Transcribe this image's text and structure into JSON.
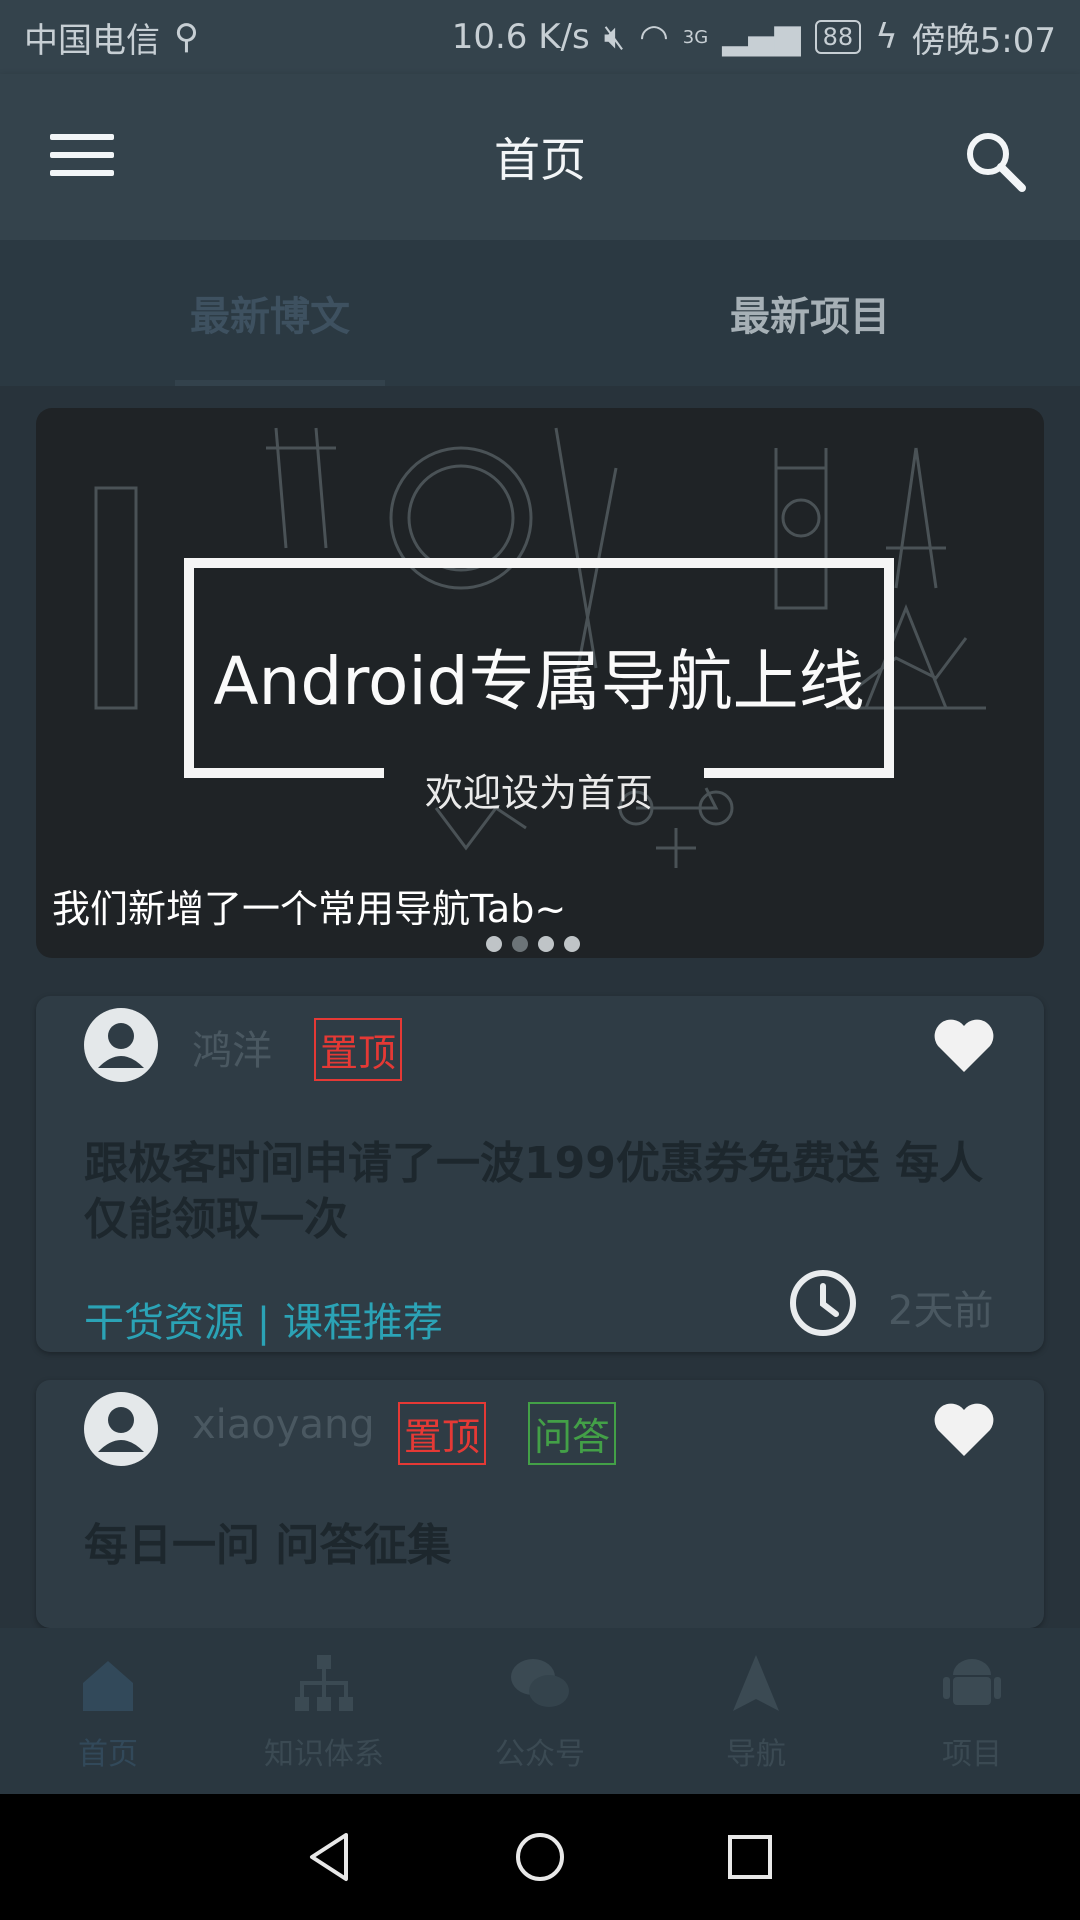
{
  "status_bar": {
    "carrier": "中国电信",
    "speed": "10.6 K/s",
    "network": "3G",
    "battery": "88",
    "time": "傍晚5:07"
  },
  "toolbar": {
    "title": "首页"
  },
  "tabs": [
    {
      "label": "最新博文",
      "active": true
    },
    {
      "label": "最新项目",
      "active": false
    }
  ],
  "banner": {
    "headline": "Android专属导航上线",
    "sub": "欢迎设为首页",
    "caption": "我们新增了一个常用导航Tab~",
    "page_count": 4,
    "active_index": 1
  },
  "articles": [
    {
      "author": "鸿洋",
      "tags": [
        "置顶"
      ],
      "title": "跟极客时间申请了一波199优惠券免费送 每人仅能领取一次",
      "chapter": "干货资源 | 课程推荐",
      "time": "2天前"
    },
    {
      "author": "xiaoyang",
      "tags": [
        "置顶",
        "问答"
      ],
      "title": "每日一问 问答征集"
    }
  ],
  "bottom_nav": [
    {
      "label": "首页",
      "icon": "home-icon",
      "active": true
    },
    {
      "label": "知识体系",
      "icon": "hierarchy-icon",
      "active": false
    },
    {
      "label": "公众号",
      "icon": "chat-icon",
      "active": false
    },
    {
      "label": "导航",
      "icon": "navigation-icon",
      "active": false
    },
    {
      "label": "项目",
      "icon": "android-icon",
      "active": false
    }
  ],
  "colors": {
    "tag_red": "#e53935",
    "tag_green": "#43a047",
    "chapter": "#2ba3b6"
  }
}
